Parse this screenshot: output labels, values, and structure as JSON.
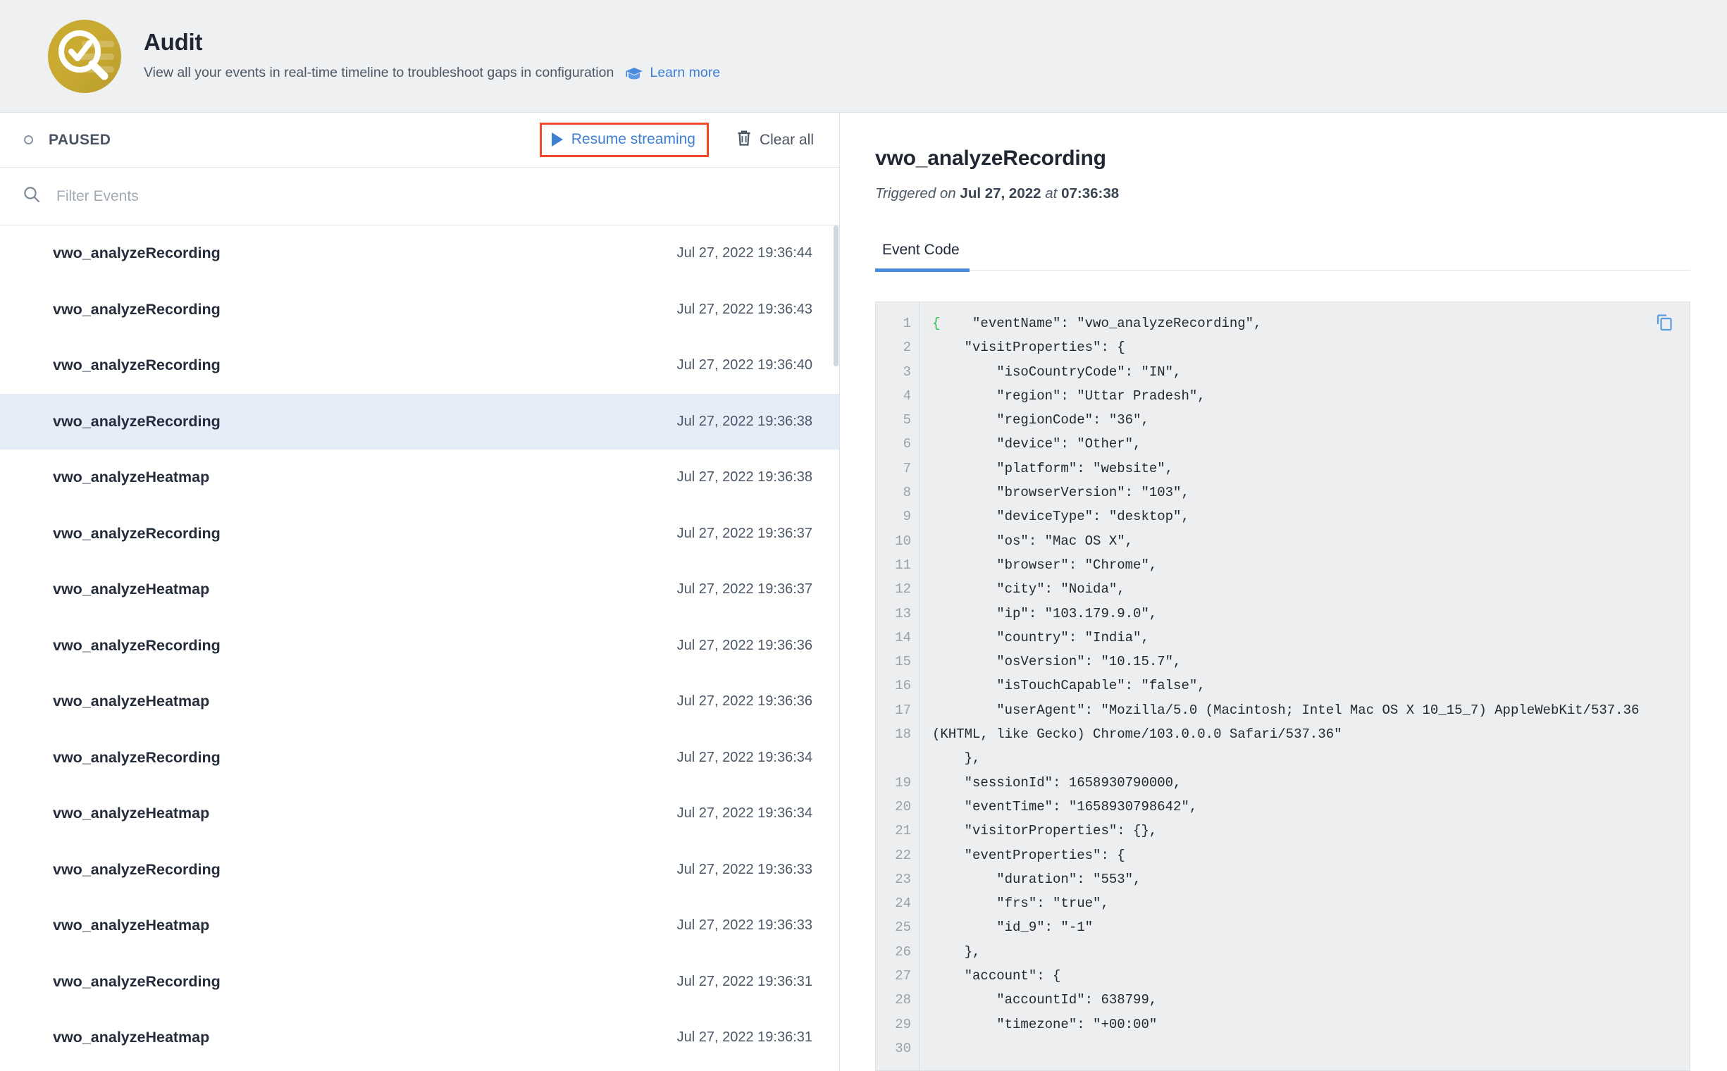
{
  "header": {
    "title": "Audit",
    "subtitle": "View all your events in real-time timeline to troubleshoot gaps in configuration",
    "learn_more": "Learn more",
    "logo_icon": "audit-magnifier-check-icon",
    "learn_more_icon": "graduation-cap-icon",
    "brand_gold": "#c9a92e",
    "link_blue": "#3e7fd4"
  },
  "stream_bar": {
    "status": "PAUSED",
    "status_icon": "paused-circle-icon",
    "resume_label": "Resume streaming",
    "resume_icon": "play-icon",
    "clear_label": "Clear all",
    "clear_icon": "trash-icon",
    "highlight_color": "#f1492a"
  },
  "filter": {
    "placeholder": "Filter Events",
    "value": "",
    "icon": "search-icon"
  },
  "events": [
    {
      "name": "vwo_analyzeRecording",
      "time": "Jul 27, 2022 19:36:44",
      "selected": false
    },
    {
      "name": "vwo_analyzeRecording",
      "time": "Jul 27, 2022 19:36:43",
      "selected": false
    },
    {
      "name": "vwo_analyzeRecording",
      "time": "Jul 27, 2022 19:36:40",
      "selected": false
    },
    {
      "name": "vwo_analyzeRecording",
      "time": "Jul 27, 2022 19:36:38",
      "selected": true
    },
    {
      "name": "vwo_analyzeHeatmap",
      "time": "Jul 27, 2022 19:36:38",
      "selected": false
    },
    {
      "name": "vwo_analyzeRecording",
      "time": "Jul 27, 2022 19:36:37",
      "selected": false
    },
    {
      "name": "vwo_analyzeHeatmap",
      "time": "Jul 27, 2022 19:36:37",
      "selected": false
    },
    {
      "name": "vwo_analyzeRecording",
      "time": "Jul 27, 2022 19:36:36",
      "selected": false
    },
    {
      "name": "vwo_analyzeHeatmap",
      "time": "Jul 27, 2022 19:36:36",
      "selected": false
    },
    {
      "name": "vwo_analyzeRecording",
      "time": "Jul 27, 2022 19:36:34",
      "selected": false
    },
    {
      "name": "vwo_analyzeHeatmap",
      "time": "Jul 27, 2022 19:36:34",
      "selected": false
    },
    {
      "name": "vwo_analyzeRecording",
      "time": "Jul 27, 2022 19:36:33",
      "selected": false
    },
    {
      "name": "vwo_analyzeHeatmap",
      "time": "Jul 27, 2022 19:36:33",
      "selected": false
    },
    {
      "name": "vwo_analyzeRecording",
      "time": "Jul 27, 2022 19:36:31",
      "selected": false
    },
    {
      "name": "vwo_analyzeHeatmap",
      "time": "Jul 27, 2022 19:36:31",
      "selected": false
    }
  ],
  "detail": {
    "title": "vwo_analyzeRecording",
    "triggered_prefix": "Triggered on",
    "triggered_date": "Jul 27, 2022",
    "triggered_at_word": "at",
    "triggered_time": "07:36:38",
    "tab_label": "Event Code",
    "copy_icon": "copy-icon",
    "line_numbers": [
      "1",
      "2",
      "3",
      "4",
      "5",
      "6",
      "7",
      "8",
      "9",
      "10",
      "11",
      "12",
      "13",
      "14",
      "15",
      "16",
      "17",
      "18",
      "19",
      "20",
      "21",
      "22",
      "23",
      "24",
      "25",
      "26",
      "27",
      "28",
      "29",
      "30"
    ],
    "code_open_brace": "{",
    "code_body": "    \"eventName\": \"vwo_analyzeRecording\",\n    \"visitProperties\": {\n        \"isoCountryCode\": \"IN\",\n        \"region\": \"Uttar Pradesh\",\n        \"regionCode\": \"36\",\n        \"device\": \"Other\",\n        \"platform\": \"website\",\n        \"browserVersion\": \"103\",\n        \"deviceType\": \"desktop\",\n        \"os\": \"Mac OS X\",\n        \"browser\": \"Chrome\",\n        \"city\": \"Noida\",\n        \"ip\": \"103.179.9.0\",\n        \"country\": \"India\",\n        \"osVersion\": \"10.15.7\",\n        \"isTouchCapable\": \"false\",\n        \"userAgent\": \"Mozilla/5.0 (Macintosh; Intel Mac OS X 10_15_7) AppleWebKit/537.36 (KHTML, like Gecko) Chrome/103.0.0.0 Safari/537.36\"\n    },\n    \"sessionId\": 1658930790000,\n    \"eventTime\": \"1658930798642\",\n    \"visitorProperties\": {},\n    \"eventProperties\": {\n        \"duration\": \"553\",\n        \"frs\": \"true\",\n        \"id_9\": \"-1\"\n    },\n    \"account\": {\n        \"accountId\": 638799,\n        \"timezone\": \"+00:00\""
  }
}
